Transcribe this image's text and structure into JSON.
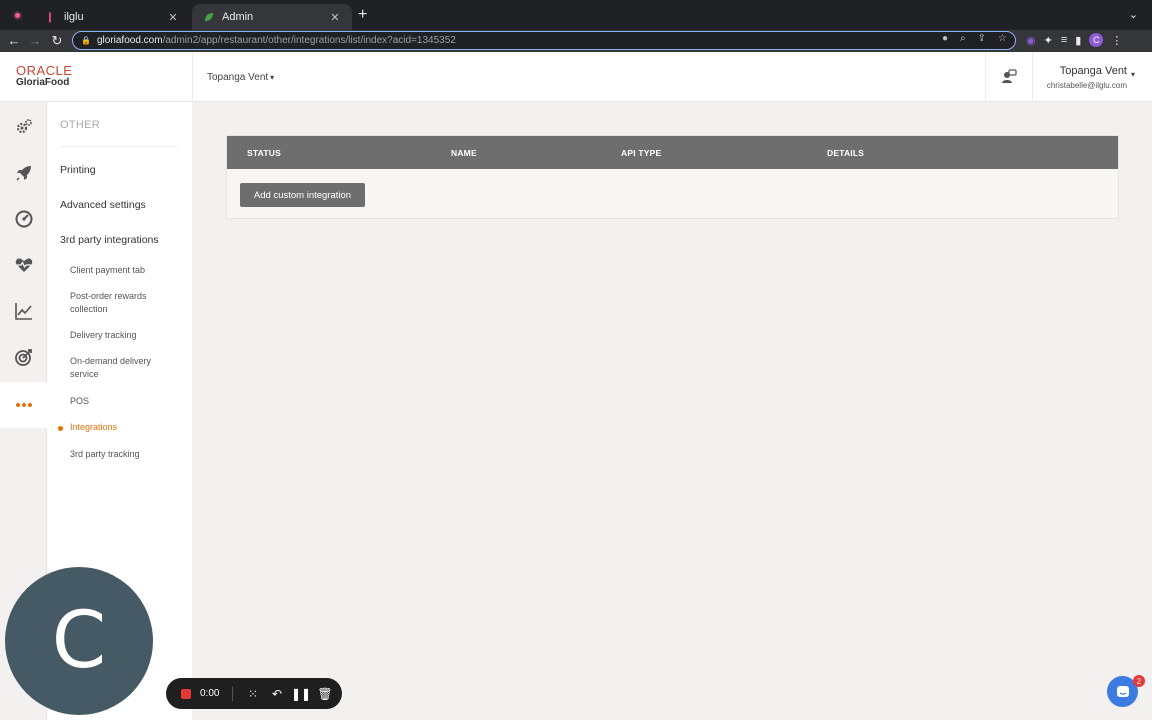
{
  "browser": {
    "tabs": [
      {
        "title": "ilglu",
        "close": "✕"
      },
      {
        "title": "Admin",
        "close": "✕"
      }
    ],
    "new_tab": "+",
    "url_host": "gloriafood.com",
    "url_path": "/admin2/app/restaurant/other/integrations/list/index?acid=1345352",
    "profile_initial": "C"
  },
  "header": {
    "logo_line1": "ORACLE",
    "logo_line2": "GloriaFood",
    "restaurant": "Topanga Vent",
    "user_name": "Topanga Vent",
    "user_email": "christabelle@ilglu.com"
  },
  "rail": {
    "icons": [
      "setup-gears-icon",
      "rocket-icon",
      "gauge-icon",
      "heart-pulse-icon",
      "chart-line-icon",
      "target-icon",
      "more-dots-icon"
    ],
    "active_index": 6,
    "accent_color": "#e8710a"
  },
  "sidemenu": {
    "section_title": "OTHER",
    "items": [
      "Printing",
      "Advanced settings",
      "3rd party integrations"
    ],
    "sub_items": [
      "Client payment tab",
      "Post-order rewards collection",
      "Delivery tracking",
      "On-demand delivery service",
      "POS",
      "Integrations",
      "3rd party tracking"
    ],
    "active_sub": "Integrations"
  },
  "table": {
    "columns": [
      "STATUS",
      "NAME",
      "API TYPE",
      "DETAILS"
    ],
    "add_button": "Add custom integration"
  },
  "overlay": {
    "avatar_letter": "C",
    "rec_time": "0:00",
    "chat_badge": "2"
  }
}
